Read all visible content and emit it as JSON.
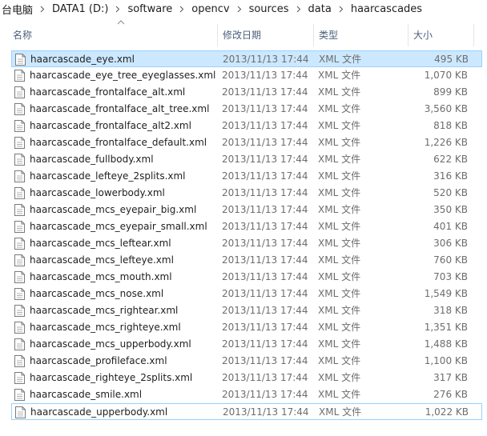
{
  "breadcrumb": {
    "items": [
      "台电脑",
      "DATA1 (D:)",
      "software",
      "opencv",
      "sources",
      "data",
      "haarcascades"
    ]
  },
  "columns": {
    "name": "名称",
    "date": "修改日期",
    "type": "类型",
    "size": "大小",
    "sort_indicator": "sort-ascending-icon"
  },
  "colors": {
    "selected_bg": "#cce8ff",
    "selected_border": "#99d1ff",
    "header_text": "#4c607a"
  },
  "files": [
    {
      "name": "haarcascade_eye.xml",
      "date": "2013/11/13 17:44",
      "type": "XML 文件",
      "size": "495 KB",
      "state": "selected"
    },
    {
      "name": "haarcascade_eye_tree_eyeglasses.xml",
      "date": "2013/11/13 17:44",
      "type": "XML 文件",
      "size": "1,070 KB",
      "state": ""
    },
    {
      "name": "haarcascade_frontalface_alt.xml",
      "date": "2013/11/13 17:44",
      "type": "XML 文件",
      "size": "899 KB",
      "state": ""
    },
    {
      "name": "haarcascade_frontalface_alt_tree.xml",
      "date": "2013/11/13 17:44",
      "type": "XML 文件",
      "size": "3,560 KB",
      "state": ""
    },
    {
      "name": "haarcascade_frontalface_alt2.xml",
      "date": "2013/11/13 17:44",
      "type": "XML 文件",
      "size": "818 KB",
      "state": ""
    },
    {
      "name": "haarcascade_frontalface_default.xml",
      "date": "2013/11/13 17:44",
      "type": "XML 文件",
      "size": "1,226 KB",
      "state": ""
    },
    {
      "name": "haarcascade_fullbody.xml",
      "date": "2013/11/13 17:44",
      "type": "XML 文件",
      "size": "622 KB",
      "state": ""
    },
    {
      "name": "haarcascade_lefteye_2splits.xml",
      "date": "2013/11/13 17:44",
      "type": "XML 文件",
      "size": "316 KB",
      "state": ""
    },
    {
      "name": "haarcascade_lowerbody.xml",
      "date": "2013/11/13 17:44",
      "type": "XML 文件",
      "size": "520 KB",
      "state": ""
    },
    {
      "name": "haarcascade_mcs_eyepair_big.xml",
      "date": "2013/11/13 17:44",
      "type": "XML 文件",
      "size": "350 KB",
      "state": ""
    },
    {
      "name": "haarcascade_mcs_eyepair_small.xml",
      "date": "2013/11/13 17:44",
      "type": "XML 文件",
      "size": "401 KB",
      "state": ""
    },
    {
      "name": "haarcascade_mcs_leftear.xml",
      "date": "2013/11/13 17:44",
      "type": "XML 文件",
      "size": "306 KB",
      "state": ""
    },
    {
      "name": "haarcascade_mcs_lefteye.xml",
      "date": "2013/11/13 17:44",
      "type": "XML 文件",
      "size": "760 KB",
      "state": ""
    },
    {
      "name": "haarcascade_mcs_mouth.xml",
      "date": "2013/11/13 17:44",
      "type": "XML 文件",
      "size": "703 KB",
      "state": ""
    },
    {
      "name": "haarcascade_mcs_nose.xml",
      "date": "2013/11/13 17:44",
      "type": "XML 文件",
      "size": "1,549 KB",
      "state": ""
    },
    {
      "name": "haarcascade_mcs_rightear.xml",
      "date": "2013/11/13 17:44",
      "type": "XML 文件",
      "size": "318 KB",
      "state": ""
    },
    {
      "name": "haarcascade_mcs_righteye.xml",
      "date": "2013/11/13 17:44",
      "type": "XML 文件",
      "size": "1,351 KB",
      "state": ""
    },
    {
      "name": "haarcascade_mcs_upperbody.xml",
      "date": "2013/11/13 17:44",
      "type": "XML 文件",
      "size": "1,488 KB",
      "state": ""
    },
    {
      "name": "haarcascade_profileface.xml",
      "date": "2013/11/13 17:44",
      "type": "XML 文件",
      "size": "1,100 KB",
      "state": ""
    },
    {
      "name": "haarcascade_righteye_2splits.xml",
      "date": "2013/11/13 17:44",
      "type": "XML 文件",
      "size": "317 KB",
      "state": ""
    },
    {
      "name": "haarcascade_smile.xml",
      "date": "2013/11/13 17:44",
      "type": "XML 文件",
      "size": "276 KB",
      "state": ""
    },
    {
      "name": "haarcascade_upperbody.xml",
      "date": "2013/11/13 17:44",
      "type": "XML 文件",
      "size": "1,022 KB",
      "state": "focused"
    }
  ]
}
